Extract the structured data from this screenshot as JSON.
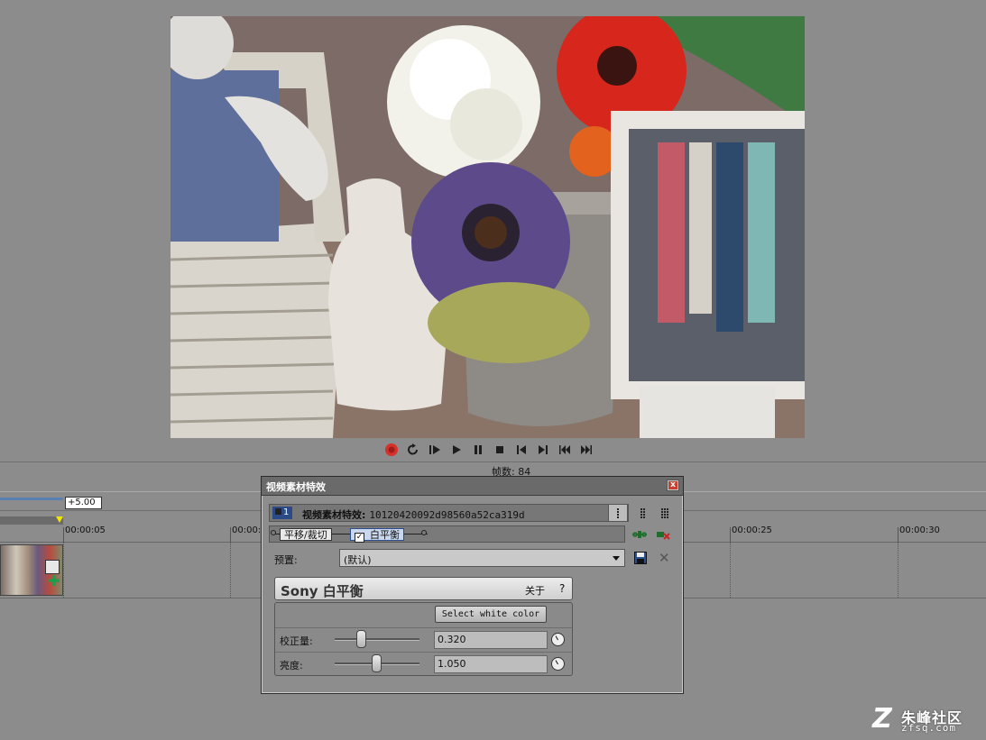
{
  "preview": {
    "description_icon": "video-preview-image"
  },
  "transport": {
    "buttons": [
      "record-icon",
      "loop-icon",
      "play-from-start-icon",
      "play-icon",
      "pause-icon",
      "stop-icon",
      "prev-frame-icon",
      "next-frame-icon",
      "prev-marker-icon",
      "next-marker-icon"
    ]
  },
  "frame_info": {
    "label": "帧数: 84"
  },
  "timeline": {
    "rate": "+5.00",
    "ticks": [
      "00:00:05",
      "00:00:",
      "00:00:25",
      "00:00:30"
    ]
  },
  "dialog": {
    "title": "视频素材特效",
    "close_label": "x",
    "track_index": "1",
    "effect_heading": "视频素材特效:",
    "clip_name": "10120420092d98560a52ca319d",
    "chain": {
      "item1": "平移/裁切",
      "item2": "白平衡",
      "item2_checked": "✓"
    },
    "preset_label": "预置:",
    "preset_value": "(默认)",
    "plugin": {
      "name": "Sony 白平衡",
      "about": "关于",
      "help": "?",
      "select_white_button": "Select white color",
      "params": [
        {
          "label": "校正量:",
          "value": "0.320",
          "slider_fraction": 0.32
        },
        {
          "label": "亮度:",
          "value": "1.050",
          "slider_fraction": 0.525
        }
      ]
    }
  },
  "watermark": {
    "cn": "朱峰社区",
    "en": "zfsq.com"
  },
  "colors": {
    "record": "#d6312b",
    "selected_chain": "#c9d8ef",
    "title_bar": "#6a6a6a",
    "close": "#c8412e"
  }
}
